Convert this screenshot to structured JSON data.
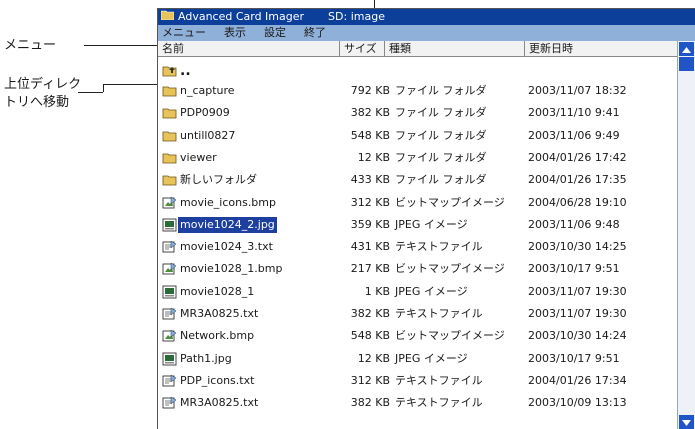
{
  "callouts": {
    "menu": "メニュー",
    "up_line1": "上位ディレク",
    "up_line2": "トリへ移動"
  },
  "titlebar": {
    "app_name": "Advanced Card Imager",
    "path": "SD: image"
  },
  "menu": [
    "メニュー",
    "表示",
    "設定",
    "終了"
  ],
  "columns": {
    "name": "名前",
    "size": "サイズ",
    "type": "種類",
    "modified": "更新日時"
  },
  "parent_entry": "..",
  "files": [
    {
      "name": "n_capture",
      "size": "792 KB",
      "type": "ファイル フォルダ",
      "modified": "2003/11/07 18:32",
      "icon": "folder-icon"
    },
    {
      "name": "PDP0909",
      "size": "382 KB",
      "type": "ファイル フォルダ",
      "modified": "2003/11/10 9:41",
      "icon": "folder-icon"
    },
    {
      "name": "untill0827",
      "size": "548 KB",
      "type": "ファイル フォルダ",
      "modified": "2003/11/06 9:49",
      "icon": "folder-icon"
    },
    {
      "name": "viewer",
      "size": "12 KB",
      "type": "ファイル フォルダ",
      "modified": "2004/01/26 17:42",
      "icon": "folder-icon"
    },
    {
      "name": "新しいフォルダ",
      "size": "433 KB",
      "type": "ファイル フォルダ",
      "modified": "2004/01/26 17:35",
      "icon": "folder-icon"
    },
    {
      "name": "movie_icons.bmp",
      "size": "312 KB",
      "type": "ビットマップイメージ",
      "modified": "2004/06/28 19:10",
      "icon": "bitmap-file-icon"
    },
    {
      "name": "movie1024_2.jpg",
      "size": "359 KB",
      "type": "JPEG イメージ",
      "modified": "2003/11/06 9:48",
      "icon": "jpeg-file-icon",
      "selected": true
    },
    {
      "name": "movie1024_3.txt",
      "size": "431 KB",
      "type": "テキストファイル",
      "modified": "2003/10/30 14:25",
      "icon": "text-file-icon"
    },
    {
      "name": "movie1028_1.bmp",
      "size": "217 KB",
      "type": "ビットマップイメージ",
      "modified": "2003/10/17 9:51",
      "icon": "bitmap-file-icon"
    },
    {
      "name": "movie1028_1",
      "size": "1 KB",
      "type": "JPEG イメージ",
      "modified": "2003/11/07 19:30",
      "icon": "jpeg-file-icon"
    },
    {
      "name": "MR3A0825.txt",
      "size": "382 KB",
      "type": "テキストファイル",
      "modified": "2003/11/07 19:30",
      "icon": "text-file-icon"
    },
    {
      "name": "Network.bmp",
      "size": "548 KB",
      "type": "ビットマップイメージ",
      "modified": "2003/10/30 14:24",
      "icon": "bitmap-file-icon"
    },
    {
      "name": "Path1.jpg",
      "size": "12 KB",
      "type": "JPEG イメージ",
      "modified": "2003/10/17 9:51",
      "icon": "jpeg-file-icon"
    },
    {
      "name": "PDP_icons.txt",
      "size": "312 KB",
      "type": "テキストファイル",
      "modified": "2004/01/26 17:34",
      "icon": "text-file-icon"
    },
    {
      "name": "MR3A0825.txt",
      "size": "382 KB",
      "type": "テキストファイル",
      "modified": "2003/10/09 13:13",
      "icon": "text-file-icon"
    }
  ],
  "colors": {
    "titlebar": "#0b3f9a",
    "menubar": "#8fb0d8",
    "selection": "#1c3fa0",
    "scroll": "#1f55c7"
  }
}
